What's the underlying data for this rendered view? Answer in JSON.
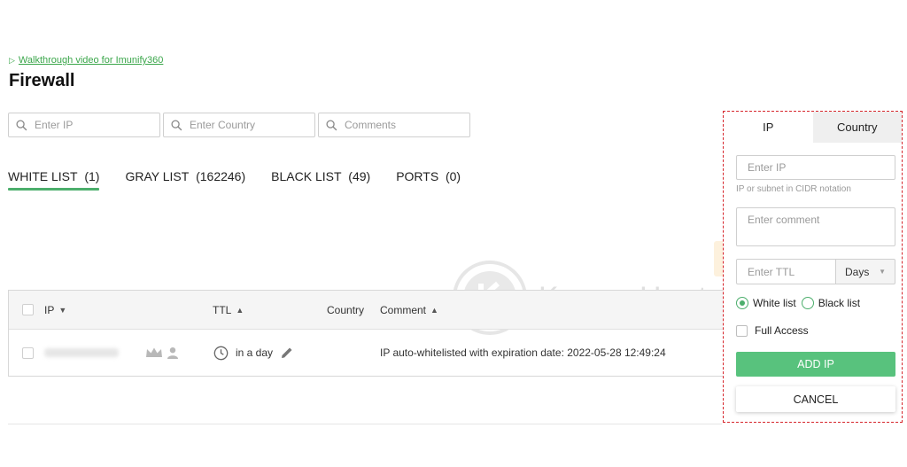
{
  "header": {
    "walkthrough_link": "Walkthrough video for Imunify360",
    "title": "Firewall"
  },
  "filters": {
    "ip_placeholder": "Enter IP",
    "country_placeholder": "Enter Country",
    "comments_placeholder": "Comments"
  },
  "tabs": [
    {
      "label": "WHITE LIST",
      "count": "(1)",
      "active": true
    },
    {
      "label": "GRAY LIST",
      "count": "(162246)",
      "active": false
    },
    {
      "label": "BLACK LIST",
      "count": "(49)",
      "active": false
    },
    {
      "label": "PORTS",
      "count": "(0)",
      "active": false
    }
  ],
  "table": {
    "columns": {
      "ip": "IP",
      "ttl": "TTL",
      "country": "Country",
      "comment": "Comment"
    },
    "rows": [
      {
        "ttl": "in a day",
        "comment": "IP auto-whitelisted with expiration date: 2022-05-28 12:49:24"
      }
    ]
  },
  "watermark": "KnownHost",
  "panel": {
    "tab_ip": "IP",
    "tab_country": "Country",
    "ip_placeholder": "Enter IP",
    "ip_hint": "IP or subnet in CIDR notation",
    "comment_placeholder": "Enter comment",
    "ttl_placeholder": "Enter TTL",
    "ttl_unit": "Days",
    "radio_white": "White list",
    "radio_black": "Black list",
    "full_access": "Full Access",
    "add_button": "ADD IP",
    "cancel_button": "CANCEL"
  },
  "colors": {
    "accent_green": "#4cae6c",
    "button_green": "#58c27d",
    "highlight_red": "#d6262c"
  }
}
